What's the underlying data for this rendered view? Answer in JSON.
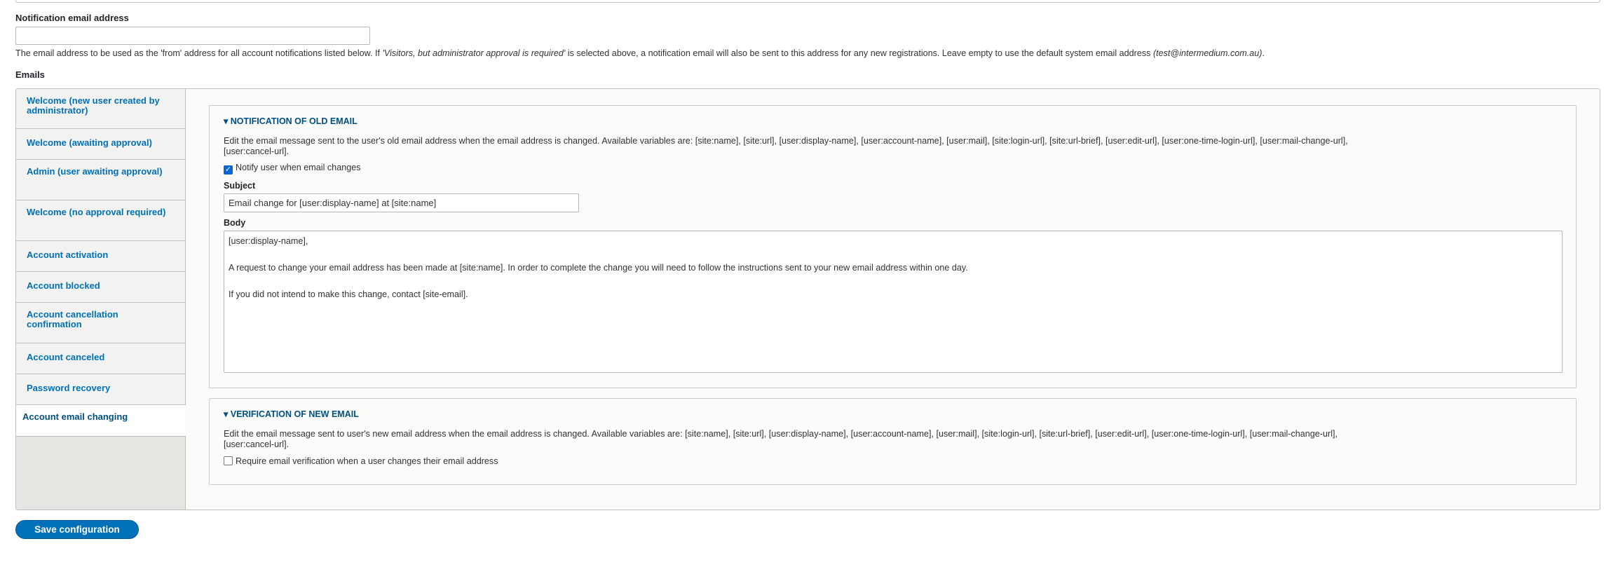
{
  "notification_email": {
    "label": "Notification email address",
    "value": "",
    "description_1": "The email address to be used as the 'from' address for all account notifications listed below. If ",
    "description_em": "'Visitors, but administrator approval is required'",
    "description_2": " is selected above, a notification email will also be sent to this address for any new registrations. Leave empty to use the default system email address ",
    "description_email": "(test@intermedium.com.au)",
    "description_end": "."
  },
  "emails_label": "Emails",
  "tabs": [
    {
      "label": "Welcome (new user created by administrator)"
    },
    {
      "label": "Welcome (awaiting approval)"
    },
    {
      "label": "Admin (user awaiting approval)"
    },
    {
      "label": "Welcome (no approval required)"
    },
    {
      "label": "Account activation"
    },
    {
      "label": "Account blocked"
    },
    {
      "label": "Account cancellation confirmation"
    },
    {
      "label": "Account canceled"
    },
    {
      "label": "Password recovery"
    },
    {
      "label": "Account email changing",
      "active": true
    }
  ],
  "old_email": {
    "title": "Notification of old email",
    "description_1": "Edit the email message sent to the user's old email address when the email address is changed. Available variables are: [site:name], [site:url], [user:display-name], [user:account-name], [user:mail], [site:login-url], [site:url-brief], [user:edit-url], [user:one-time-login-url], [user:mail-change-url],",
    "description_2": "[user:cancel-url].",
    "checkbox_label": "Notify user when email changes",
    "checkbox_checked": true,
    "subject_label": "Subject",
    "subject_value": "Email change for [user:display-name] at [site:name]",
    "body_label": "Body",
    "body_value": "[user:display-name],\n\nA request to change your email address has been made at [site:name]. In order to complete the change you will need to follow the instructions sent to your new email address within one day.\n\nIf you did not intend to make this change, contact [site-email]."
  },
  "new_email": {
    "title": "Verification of new email",
    "description_1": "Edit the email message sent to user's new email address when the email address is changed. Available variables are: [site:name], [site:url], [user:display-name], [user:account-name], [user:mail], [site:login-url], [site:url-brief], [user:edit-url], [user:one-time-login-url], [user:mail-change-url],",
    "description_2": "[user:cancel-url].",
    "checkbox_label": "Require email verification when a user changes their email address",
    "checkbox_checked": false
  },
  "save_button": "Save configuration"
}
